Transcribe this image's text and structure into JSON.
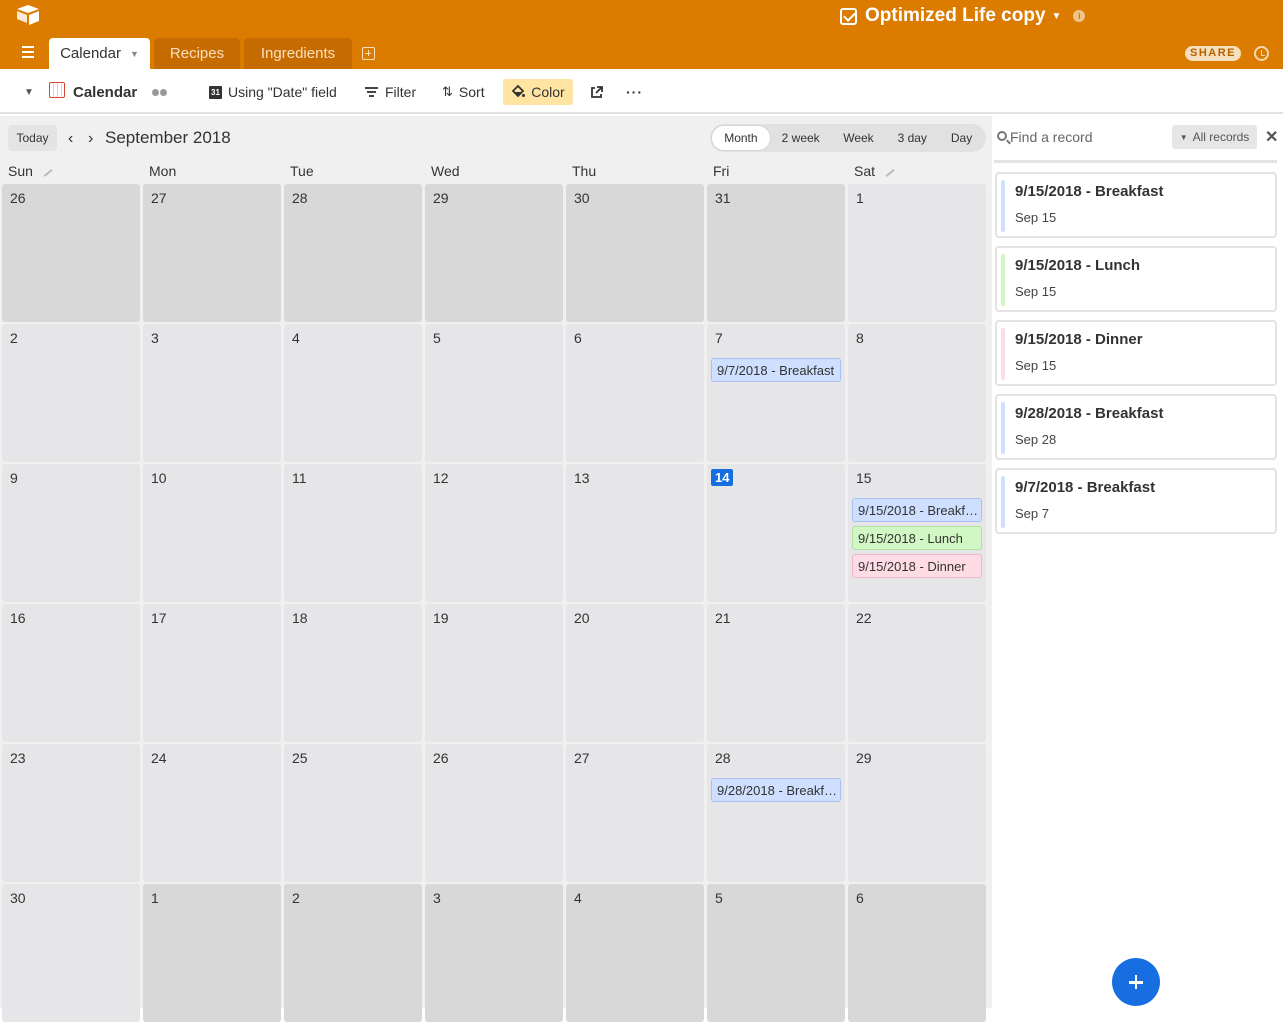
{
  "app": {
    "base_title": "Optimized Life copy",
    "tables": [
      {
        "label": "Calendar",
        "active": true
      },
      {
        "label": "Recipes",
        "active": false
      },
      {
        "label": "Ingredients",
        "active": false
      }
    ],
    "share_label": "SHARE",
    "brand_color": "#db7b00"
  },
  "toolbar": {
    "view_name": "Calendar",
    "date_field": "Using \"Date\" field",
    "filter": "Filter",
    "sort": "Sort",
    "color": "Color"
  },
  "calendar": {
    "today_label": "Today",
    "month_title": "September 2018",
    "ranges": [
      "Month",
      "2 week",
      "Week",
      "3 day",
      "Day"
    ],
    "active_range": "Month",
    "weekdays": [
      "Sun",
      "Mon",
      "Tue",
      "Wed",
      "Thu",
      "Fri",
      "Sat"
    ],
    "weeks": [
      [
        {
          "d": "26",
          "out": true
        },
        {
          "d": "27",
          "out": true
        },
        {
          "d": "28",
          "out": true
        },
        {
          "d": "29",
          "out": true
        },
        {
          "d": "30",
          "out": true
        },
        {
          "d": "31",
          "out": true
        },
        {
          "d": "1"
        }
      ],
      [
        {
          "d": "2"
        },
        {
          "d": "3"
        },
        {
          "d": "4"
        },
        {
          "d": "5"
        },
        {
          "d": "6"
        },
        {
          "d": "7",
          "events": [
            {
              "label": "9/7/2018 - Breakfast",
              "color": "blue"
            }
          ]
        },
        {
          "d": "8"
        }
      ],
      [
        {
          "d": "9"
        },
        {
          "d": "10"
        },
        {
          "d": "11"
        },
        {
          "d": "12"
        },
        {
          "d": "13"
        },
        {
          "d": "14",
          "today": true
        },
        {
          "d": "15",
          "events": [
            {
              "label": "9/15/2018 - Breakfast",
              "color": "blue"
            },
            {
              "label": "9/15/2018 - Lunch",
              "color": "green"
            },
            {
              "label": "9/15/2018 - Dinner",
              "color": "pink"
            }
          ]
        }
      ],
      [
        {
          "d": "16"
        },
        {
          "d": "17"
        },
        {
          "d": "18"
        },
        {
          "d": "19"
        },
        {
          "d": "20"
        },
        {
          "d": "21"
        },
        {
          "d": "22"
        }
      ],
      [
        {
          "d": "23"
        },
        {
          "d": "24"
        },
        {
          "d": "25"
        },
        {
          "d": "26"
        },
        {
          "d": "27"
        },
        {
          "d": "28",
          "events": [
            {
              "label": "9/28/2018 - Breakfast",
              "color": "blue"
            }
          ]
        },
        {
          "d": "29"
        }
      ],
      [
        {
          "d": "30"
        },
        {
          "d": "1",
          "out": true
        },
        {
          "d": "2",
          "out": true
        },
        {
          "d": "3",
          "out": true
        },
        {
          "d": "4",
          "out": true
        },
        {
          "d": "5",
          "out": true
        },
        {
          "d": "6",
          "out": true
        }
      ]
    ]
  },
  "sidebar": {
    "search_placeholder": "Find a record",
    "filter_label": "All records",
    "records": [
      {
        "title": "9/15/2018 - Breakfast",
        "date": "Sep 15",
        "color": "#cfdfff"
      },
      {
        "title": "9/15/2018 - Lunch",
        "date": "Sep 15",
        "color": "#d1f7c4"
      },
      {
        "title": "9/15/2018 - Dinner",
        "date": "Sep 15",
        "color": "#ffdce5"
      },
      {
        "title": "9/28/2018 - Breakfast",
        "date": "Sep 28",
        "color": "#cfdfff"
      },
      {
        "title": "9/7/2018 - Breakfast",
        "date": "Sep 7",
        "color": "#cfdfff"
      }
    ]
  }
}
